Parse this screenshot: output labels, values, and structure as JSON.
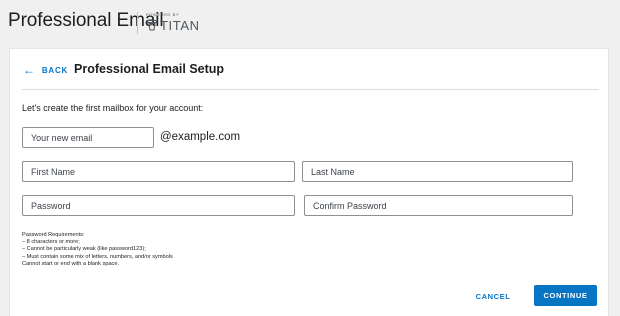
{
  "header": {
    "app_title": "Professional Email",
    "powered_by": "POWERED BY",
    "brand_name": "TITAN",
    "brand_icon": "titan-logo-icon"
  },
  "setup": {
    "back_label": "BACK",
    "back_icon": "arrow-left-icon",
    "title": "Professional Email Setup",
    "intro": "Let's create the first mailbox for your account:"
  },
  "form": {
    "email_placeholder": "Your new email",
    "email_value": "",
    "domain_suffix": "@example.com",
    "first_name_placeholder": "First Name",
    "last_name_placeholder": "Last Name",
    "password_placeholder": "Password",
    "confirm_password_placeholder": "Confirm Password"
  },
  "requirements": {
    "heading": "Password Requirements:",
    "items": [
      "– 8 characters or more;",
      "– Cannot be particularly weak (like password123);",
      "– Must contain some mix of letters, numbers, and/or symbols",
      "Cannot start or end with a blank space."
    ]
  },
  "actions": {
    "cancel_label": "CANCEL",
    "continue_label": "CONTINUE"
  },
  "colors": {
    "accent": "#0675c4",
    "background": "#f0f0f1",
    "card": "#ffffff"
  }
}
